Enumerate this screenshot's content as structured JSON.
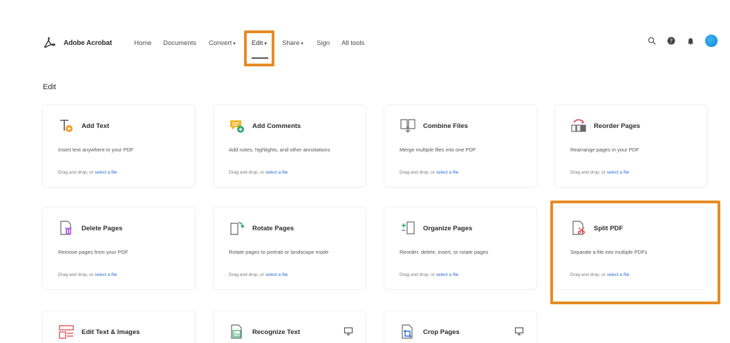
{
  "app": {
    "brand_name": "Adobe Acrobat"
  },
  "nav": {
    "items": [
      {
        "label": "Home",
        "dropdown": false
      },
      {
        "label": "Documents",
        "dropdown": false
      },
      {
        "label": "Convert",
        "dropdown": true
      },
      {
        "label": "Edit",
        "dropdown": true,
        "active": true
      },
      {
        "label": "Share",
        "dropdown": true
      },
      {
        "label": "Sign",
        "dropdown": false
      },
      {
        "label": "All tools",
        "dropdown": false
      }
    ],
    "right_icons": [
      "search-icon",
      "help-icon",
      "bell-icon",
      "avatar"
    ]
  },
  "section": {
    "title": "Edit"
  },
  "drop_prefix": "Drag and drop, or ",
  "drop_link": "select a file",
  "tools": [
    {
      "title": "Add Text",
      "desc": "Insert text anywhere in your PDF",
      "icon": "add-text-icon"
    },
    {
      "title": "Add Comments",
      "desc": "Add notes, highlights, and other annotations",
      "icon": "add-comments-icon"
    },
    {
      "title": "Combine Files",
      "desc": "Merge multiple files into one PDF",
      "icon": "combine-files-icon"
    },
    {
      "title": "Reorder Pages",
      "desc": "Rearrange pages in your PDF",
      "icon": "reorder-pages-icon"
    },
    {
      "title": "Delete Pages",
      "desc": "Remove pages from your PDF",
      "icon": "delete-pages-icon"
    },
    {
      "title": "Rotate Pages",
      "desc": "Rotate pages to portrait or landscape mode",
      "icon": "rotate-pages-icon"
    },
    {
      "title": "Organize Pages",
      "desc": "Reorder, delete, insert, or rotate pages",
      "icon": "organize-pages-icon"
    },
    {
      "title": "Split PDF",
      "desc": "Separate a file into multiple PDFs",
      "icon": "split-pdf-icon",
      "highlighted": true
    },
    {
      "title": "Edit Text & Images",
      "icon": "edit-text-images-icon"
    },
    {
      "title": "Recognize Text",
      "icon": "recognize-text-icon",
      "desktop": true
    },
    {
      "title": "Crop Pages",
      "icon": "crop-pages-icon",
      "desktop": true
    }
  ],
  "colors": {
    "highlight": "#e58b22",
    "accent_red": "#d83b3b",
    "accent_orange": "#f39a1e",
    "accent_yellow": "#f0b429",
    "accent_green": "#2fa56b",
    "link_blue": "#2a6bd3",
    "avatar_blue": "#1a8fe0"
  }
}
